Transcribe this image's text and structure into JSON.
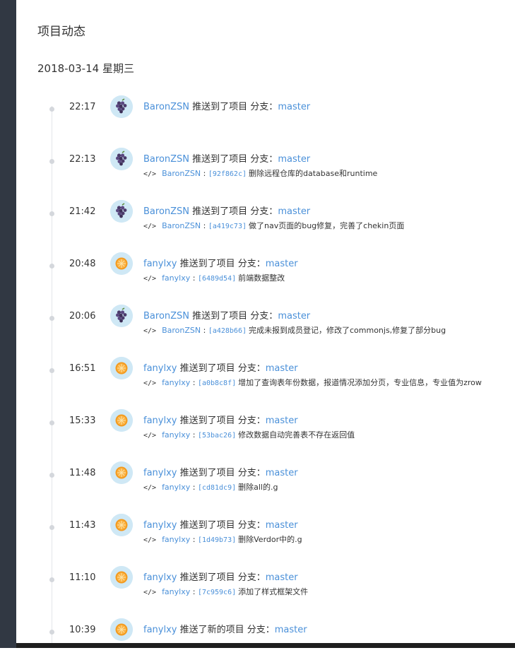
{
  "page": {
    "title": "项目动态",
    "date": "2018-03-14 星期三",
    "colors": {
      "link": "#4a90d9",
      "sidebar": "#313843",
      "timeline": "#e4e6ea"
    }
  },
  "entries": [
    {
      "time": "22:17",
      "user": "BaronZSN",
      "action": "推送到了项目 分支：",
      "branch": "master",
      "avatar": "grape",
      "commit": null
    },
    {
      "time": "22:13",
      "user": "BaronZSN",
      "action": "推送到了项目 分支：",
      "branch": "master",
      "avatar": "grape",
      "commit": {
        "user": "BaronZSN",
        "hash": "[92f862c]",
        "message": "删除远程仓库的database和runtime"
      }
    },
    {
      "time": "21:42",
      "user": "BaronZSN",
      "action": "推送到了项目 分支：",
      "branch": "master",
      "avatar": "grape",
      "commit": {
        "user": "BaronZSN",
        "hash": "[a419c73]",
        "message": "做了nav页面的bug修复，完善了chekin页面"
      }
    },
    {
      "time": "20:48",
      "user": "fanylxy",
      "action": "推送到了项目 分支：",
      "branch": "master",
      "avatar": "orange",
      "commit": {
        "user": "fanylxy",
        "hash": "[6489d54]",
        "message": "前端数据整改"
      }
    },
    {
      "time": "20:06",
      "user": "BaronZSN",
      "action": "推送到了项目 分支：",
      "branch": "master",
      "avatar": "grape",
      "commit": {
        "user": "BaronZSN",
        "hash": "[a428b66]",
        "message": "完成未报到成员登记，修改了commonjs,修复了部分bug"
      }
    },
    {
      "time": "16:51",
      "user": "fanylxy",
      "action": "推送到了项目 分支：",
      "branch": "master",
      "avatar": "orange",
      "commit": {
        "user": "fanylxy",
        "hash": "[a0b8c8f]",
        "message": "增加了查询表年份数据，报道情况添加分页，专业信息，专业值为zrow"
      }
    },
    {
      "time": "15:33",
      "user": "fanylxy",
      "action": "推送到了项目 分支：",
      "branch": "master",
      "avatar": "orange",
      "commit": {
        "user": "fanylxy",
        "hash": "[53bac26]",
        "message": "修改数据自动完善表不存在返回值"
      }
    },
    {
      "time": "11:48",
      "user": "fanylxy",
      "action": "推送到了项目 分支：",
      "branch": "master",
      "avatar": "orange",
      "commit": {
        "user": "fanylxy",
        "hash": "[cd81dc9]",
        "message": "删除all的.g"
      }
    },
    {
      "time": "11:43",
      "user": "fanylxy",
      "action": "推送到了项目 分支：",
      "branch": "master",
      "avatar": "orange",
      "commit": {
        "user": "fanylxy",
        "hash": "[1d49b73]",
        "message": "删除Verdor中的.g"
      }
    },
    {
      "time": "11:10",
      "user": "fanylxy",
      "action": "推送到了项目 分支：",
      "branch": "master",
      "avatar": "orange",
      "commit": {
        "user": "fanylxy",
        "hash": "[7c959c6]",
        "message": "添加了样式框架文件"
      }
    },
    {
      "time": "10:39",
      "user": "fanylxy",
      "action": "推送了新的项目 分支：",
      "branch": "master",
      "avatar": "orange",
      "commit": null
    }
  ]
}
